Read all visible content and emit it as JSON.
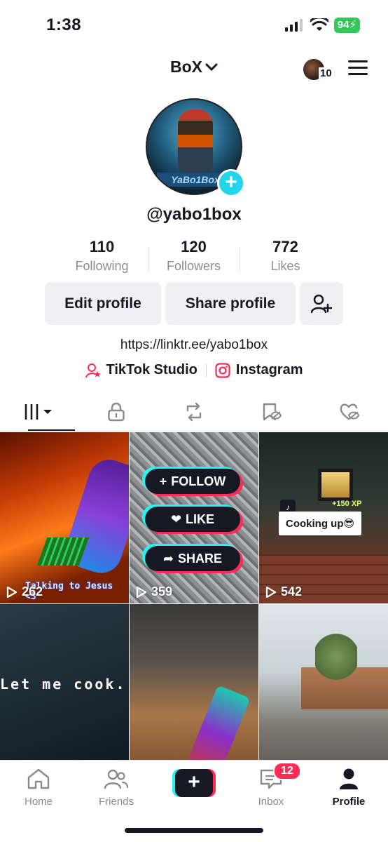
{
  "status_bar": {
    "time": "1:38",
    "battery": "94"
  },
  "header": {
    "account_name": "BoX",
    "notification_count": "10"
  },
  "profile": {
    "avatar_banner": "YaBo1Box",
    "username": "@yabo1box",
    "stats": [
      {
        "value": "110",
        "label": "Following"
      },
      {
        "value": "120",
        "label": "Followers"
      },
      {
        "value": "772",
        "label": "Likes"
      }
    ],
    "buttons": {
      "edit": "Edit profile",
      "share": "Share profile"
    },
    "bio_link": "https://linktr.ee/yabo1box",
    "links": {
      "studio": "TikTok Studio",
      "instagram": "Instagram"
    }
  },
  "tabs": [
    "videos-grid",
    "private",
    "reposts",
    "favorites",
    "liked"
  ],
  "videos": [
    {
      "views": "262",
      "caption": "Talking to Jesus <3"
    },
    {
      "views": "359",
      "overlay": [
        "FOLLOW",
        "LIKE",
        "SHARE"
      ]
    },
    {
      "views": "542",
      "caption": "Cooking up😎",
      "xp": "+150 XP"
    },
    {
      "views": "",
      "caption": "Let me cook..."
    },
    {
      "views": ""
    },
    {
      "views": ""
    }
  ],
  "bottom_nav": {
    "home": "Home",
    "friends": "Friends",
    "inbox": "Inbox",
    "inbox_badge": "12",
    "profile": "Profile"
  },
  "colors": {
    "accent_cyan": "#25f4ee",
    "accent_red": "#fe2c55",
    "text": "#161823",
    "muted": "#8a8b91"
  }
}
